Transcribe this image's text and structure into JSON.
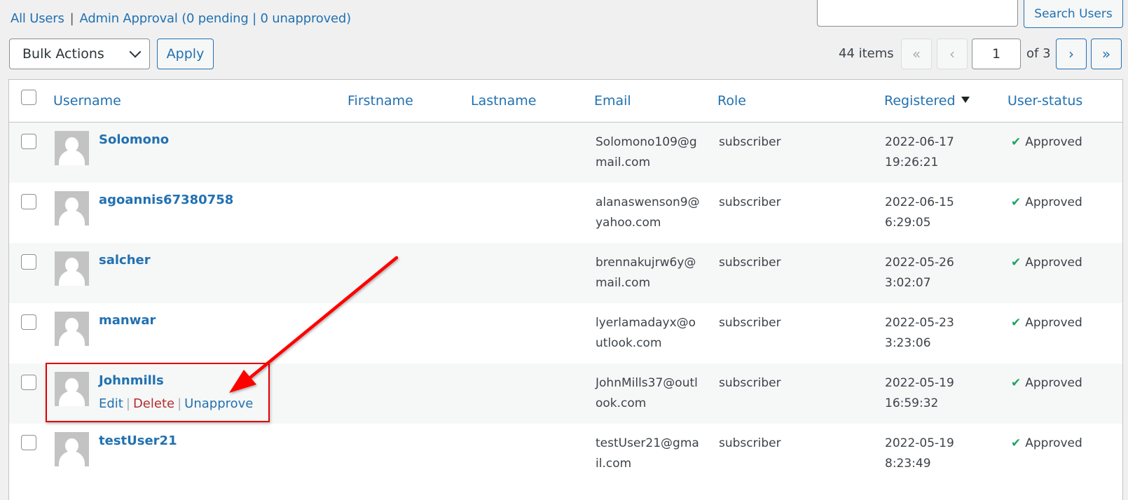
{
  "subsubsub": {
    "all_users": "All Users",
    "separator": "|",
    "admin_approval": "Admin Approval (0 pending | 0 unapproved)"
  },
  "search": {
    "value": "",
    "placeholder": "",
    "button_label": "Search Users"
  },
  "bulk_actions": {
    "selected": "Bulk Actions",
    "apply_label": "Apply"
  },
  "pagination": {
    "items_count": "44 items",
    "first": "«",
    "prev": "‹",
    "current_page": "1",
    "of_total": "of 3",
    "next": "›",
    "last": "»"
  },
  "table": {
    "columns": {
      "username": "Username",
      "firstname": "Firstname",
      "lastname": "Lastname",
      "email": "Email",
      "role": "Role",
      "registered": "Registered",
      "user_status": "User-status"
    },
    "sorted_by": "registered",
    "sort_direction": "desc",
    "status_check_icon": "✔",
    "rows": [
      {
        "username": "Solomono",
        "firstname": "",
        "lastname": "",
        "email": "Solomono109@gmail.com",
        "role": "subscriber",
        "registered": "2022-06-17 19:26:21",
        "status": "Approved"
      },
      {
        "username": "agoannis67380758",
        "firstname": "",
        "lastname": "",
        "email": "alanaswenson9@yahoo.com",
        "role": "subscriber",
        "registered": "2022-06-15 6:29:05",
        "status": "Approved"
      },
      {
        "username": "salcher",
        "firstname": "",
        "lastname": "",
        "email": "brennakujrw6y@mail.com",
        "role": "subscriber",
        "registered": "2022-05-26 3:02:07",
        "status": "Approved"
      },
      {
        "username": "manwar",
        "firstname": "",
        "lastname": "",
        "email": "lyerlamadayx@outlook.com",
        "role": "subscriber",
        "registered": "2022-05-23 3:23:06",
        "status": "Approved"
      },
      {
        "username": "Johnmills",
        "firstname": "",
        "lastname": "",
        "email": "JohnMills37@outlook.com",
        "role": "subscriber",
        "registered": "2022-05-19 16:59:32",
        "status": "Approved",
        "row_actions": {
          "edit": "Edit",
          "delete": "Delete",
          "unapprove": "Unapprove",
          "separator": "|"
        }
      },
      {
        "username": "testUser21",
        "firstname": "",
        "lastname": "",
        "email": "testUser21@gmail.com",
        "role": "subscriber",
        "registered": "2022-05-19 8:23:49",
        "status": "Approved"
      }
    ]
  },
  "annotation": {
    "color": "#e00000",
    "target": "Johnmills row actions"
  },
  "colors": {
    "link": "#2271b1",
    "delete": "#b32d2e",
    "approved_check": "#1ea366",
    "alt_row": "#f6f7f7"
  }
}
